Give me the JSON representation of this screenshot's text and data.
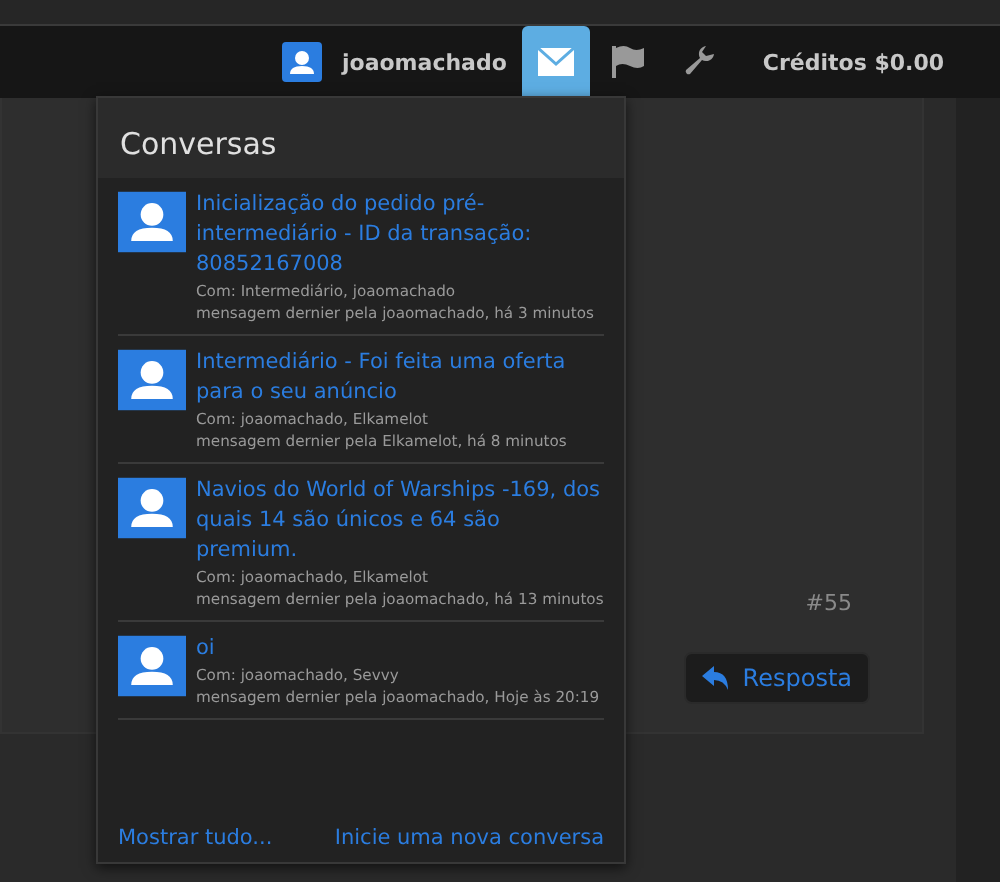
{
  "navbar": {
    "username": "joaomachado",
    "buttons": [
      {
        "kind": "mail",
        "selected": true
      },
      {
        "kind": "flag",
        "selected": false
      },
      {
        "kind": "tools",
        "selected": false
      }
    ],
    "credits": "Créditos $0.00"
  },
  "post": {
    "number": "#55",
    "reply_button": "Resposta"
  },
  "conversations": {
    "title": "Conversas",
    "items": [
      {
        "title": "Inicialização do pedido pré-intermediário - ID da transação: 80852167008",
        "participants": "Com: Intermediário, joaomachado",
        "last_message": "mensagem dernier pela joaomachado, há 3 minutos"
      },
      {
        "title": "Intermediário - Foi feita uma oferta para o seu anúncio",
        "participants": "Com: joaomachado, Elkamelot",
        "last_message": "mensagem dernier pela Elkamelot, há 8 minutos"
      },
      {
        "title": "Navios do World of Warships -169, dos quais 14 são únicos e 64 são premium.",
        "participants": "Com: joaomachado, Elkamelot",
        "last_message": "mensagem dernier pela joaomachado, há 13 minutos"
      },
      {
        "title": "oi",
        "participants": "Com: joaomachado, Sevvy",
        "last_message": "mensagem dernier pela joaomachado, Hoje às 20:19"
      }
    ],
    "show_all": "Mostrar tudo...",
    "new_conversation": "Inicie uma nova conversa"
  }
}
